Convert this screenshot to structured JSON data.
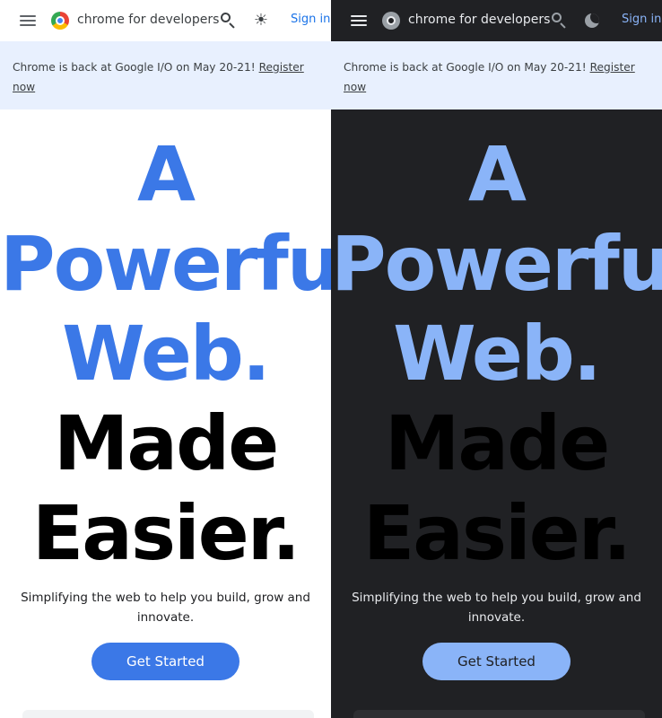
{
  "header": {
    "brand": "chrome for developers",
    "sign_in": "Sign in",
    "theme_light_icon": "sun-icon",
    "theme_dark_icon": "moon-icon"
  },
  "banner": {
    "text": "Chrome is back at Google I/O on May 20-21! ",
    "link": "Register now"
  },
  "hero": {
    "line1": "A",
    "line2": "Powerful",
    "line3": "Web.",
    "line4": "Made",
    "line5": "Easier."
  },
  "subtitle": "Simplifying the web to help you build, grow and innovate.",
  "cta": "Get Started",
  "colors": {
    "accent_light": "#3b78e7",
    "accent_dark": "#8ab4f8",
    "banner_bg": "#e8f0fe",
    "dark_bg": "#202124"
  }
}
